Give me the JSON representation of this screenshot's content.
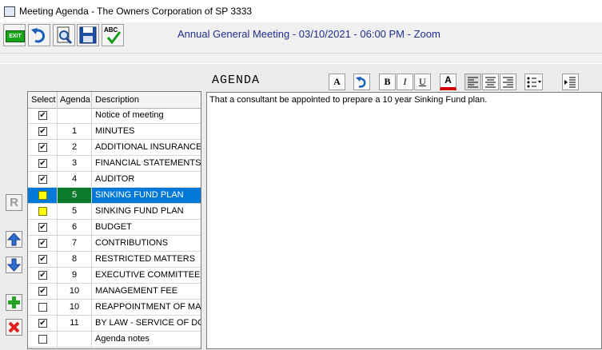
{
  "window": {
    "title": "Meeting Agenda - The Owners Corporation of SP 3333"
  },
  "toolbar": {
    "exit_label": "EXIT",
    "spell_label": "ABC",
    "meeting_info": "Annual General Meeting - 03/10/2021 - 06:00 PM - Zoom"
  },
  "sidebar": {
    "r_label": "R"
  },
  "agenda": {
    "heading": "AGENDA",
    "columns": {
      "select": "Select",
      "agenda": "Agenda",
      "description": "Description"
    },
    "rows": [
      {
        "checked": true,
        "number": "",
        "description": "Notice of meeting"
      },
      {
        "checked": true,
        "number": "1",
        "description": "MINUTES"
      },
      {
        "checked": true,
        "number": "2",
        "description": "ADDITIONAL INSURANCE"
      },
      {
        "checked": true,
        "number": "3",
        "description": "FINANCIAL STATEMENTS"
      },
      {
        "checked": true,
        "number": "4",
        "description": "AUDITOR"
      },
      {
        "checked": false,
        "number": "5",
        "description": "SINKING FUND PLAN",
        "selected": true,
        "highlight": true
      },
      {
        "checked": false,
        "number": "5",
        "description": "SINKING FUND PLAN",
        "highlight": true
      },
      {
        "checked": true,
        "number": "6",
        "description": "BUDGET"
      },
      {
        "checked": true,
        "number": "7",
        "description": "CONTRIBUTIONS"
      },
      {
        "checked": true,
        "number": "8",
        "description": "RESTRICTED MATTERS"
      },
      {
        "checked": true,
        "number": "9",
        "description": "EXECUTIVE COMMITTEE"
      },
      {
        "checked": true,
        "number": "10",
        "description": "MANAGEMENT FEE"
      },
      {
        "checked": false,
        "number": "10",
        "description": "REAPPOINTMENT OF MAI"
      },
      {
        "checked": true,
        "number": "11",
        "description": "BY LAW - SERVICE OF DO"
      },
      {
        "checked": false,
        "number": "",
        "description": "Agenda notes"
      }
    ]
  },
  "editor": {
    "content": "That a consultant be appointed to prepare a 10 year Sinking Fund plan."
  },
  "format_toolbar": {
    "font_label": "A",
    "bold_label": "B",
    "italic_label": "I",
    "underline_label": "U",
    "color_label": "A"
  },
  "colors": {
    "selection": "#0078d7",
    "selected_number_bg": "#0b7a2a",
    "highlighter": "#ffff00",
    "meeting_text": "#1f2f8f"
  }
}
